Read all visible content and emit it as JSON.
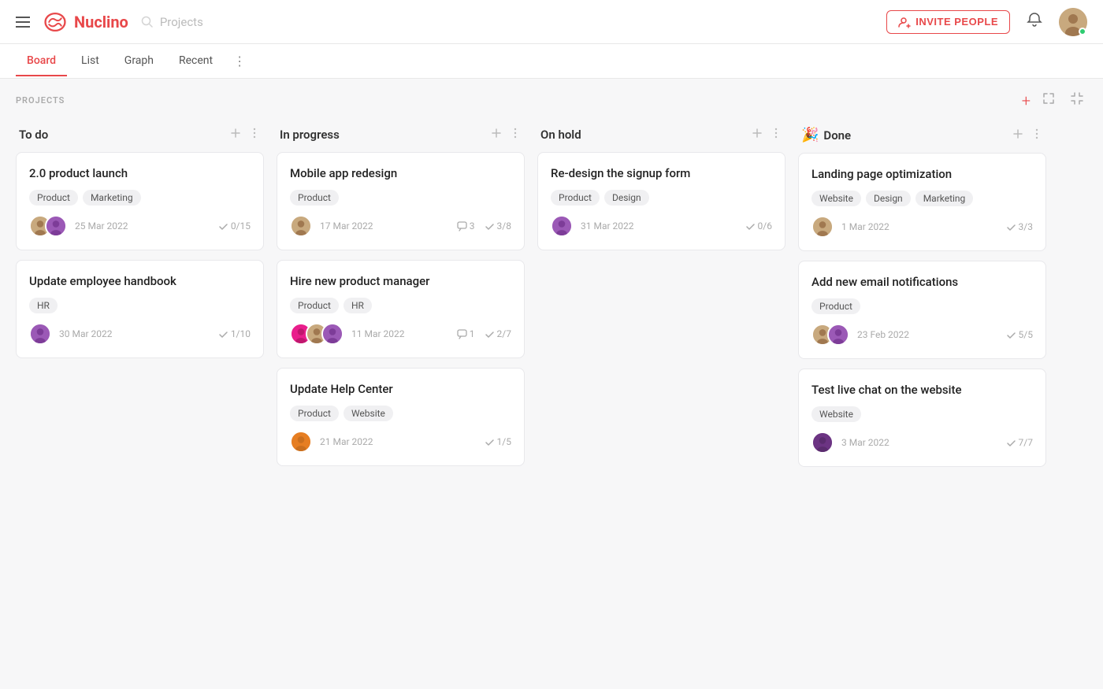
{
  "header": {
    "logo_text": "Nuclino",
    "search_placeholder": "Projects",
    "invite_label": "INVITE PEOPLE",
    "tab_board": "Board",
    "tab_list": "List",
    "tab_graph": "Graph",
    "tab_recent": "Recent"
  },
  "projects_label": "PROJECTS",
  "columns": [
    {
      "id": "todo",
      "title": "To do",
      "emoji": "",
      "cards": [
        {
          "title": "2.0 product launch",
          "tags": [
            "Product",
            "Marketing"
          ],
          "avatars": [
            "av-brown",
            "av-purple"
          ],
          "date": "25 Mar 2022",
          "checks": "0/15",
          "comments": ""
        },
        {
          "title": "Update employee handbook",
          "tags": [
            "HR"
          ],
          "avatars": [
            "av-purple"
          ],
          "date": "30 Mar 2022",
          "checks": "1/10",
          "comments": ""
        }
      ]
    },
    {
      "id": "in-progress",
      "title": "In progress",
      "emoji": "",
      "cards": [
        {
          "title": "Mobile app redesign",
          "tags": [
            "Product"
          ],
          "avatars": [
            "av-brown"
          ],
          "date": "17 Mar 2022",
          "checks": "3/8",
          "comments": "3"
        },
        {
          "title": "Hire new product manager",
          "tags": [
            "Product",
            "HR"
          ],
          "avatars": [
            "av-pink",
            "av-brown",
            "av-purple"
          ],
          "date": "11 Mar 2022",
          "checks": "2/7",
          "comments": "1"
        },
        {
          "title": "Update Help Center",
          "tags": [
            "Product",
            "Website"
          ],
          "avatars": [
            "av-orange"
          ],
          "date": "21 Mar 2022",
          "checks": "1/5",
          "comments": ""
        }
      ]
    },
    {
      "id": "on-hold",
      "title": "On hold",
      "emoji": "",
      "cards": [
        {
          "title": "Re-design the signup form",
          "tags": [
            "Product",
            "Design"
          ],
          "avatars": [
            "av-purple"
          ],
          "date": "31 Mar 2022",
          "checks": "0/6",
          "comments": ""
        }
      ]
    },
    {
      "id": "done",
      "title": "Done",
      "emoji": "🎉",
      "cards": [
        {
          "title": "Landing page optimization",
          "tags": [
            "Website",
            "Design",
            "Marketing"
          ],
          "avatars": [
            "av-brown"
          ],
          "date": "1 Mar 2022",
          "checks": "3/3",
          "comments": ""
        },
        {
          "title": "Add new email notifications",
          "tags": [
            "Product"
          ],
          "avatars": [
            "av-brown",
            "av-purple"
          ],
          "date": "23 Feb 2022",
          "checks": "5/5",
          "comments": ""
        },
        {
          "title": "Test live chat on the website",
          "tags": [
            "Website"
          ],
          "avatars": [
            "av-dark"
          ],
          "date": "3 Mar 2022",
          "checks": "7/7",
          "comments": ""
        }
      ]
    }
  ]
}
